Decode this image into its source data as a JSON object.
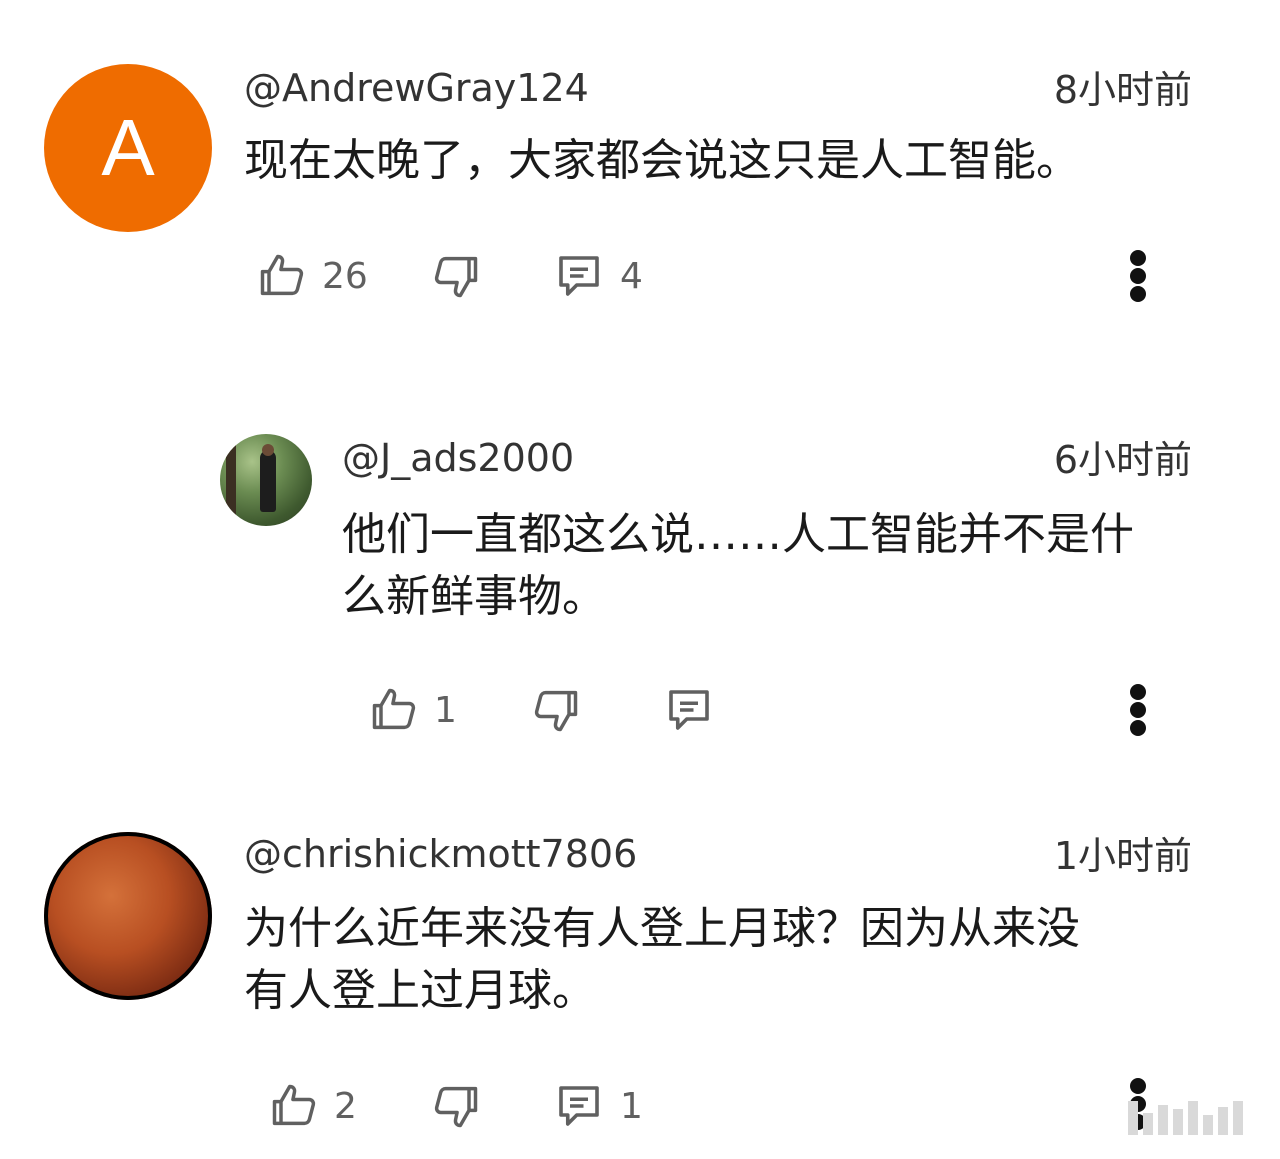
{
  "comments": [
    {
      "avatar_letter": "A",
      "username": "@AndrewGray124",
      "time": "8小时前",
      "text": "现在太晚了，大家都会说这只是人工智能。",
      "likes": "26",
      "replies": "4"
    },
    {
      "username": "@J_ads2000",
      "time": "6小时前",
      "text_line1": "他们一直都这么说……人工智能并不是什",
      "text_line2": "么新鲜事物。",
      "likes": "1"
    },
    {
      "username": "@chrishickmott7806",
      "time": "1小时前",
      "text_line1": "为什么近年来没有人登上月球？因为从来没",
      "text_line2": "有人登上过月球。",
      "likes": "2",
      "replies": "1"
    }
  ],
  "icons": {
    "like": "thumbs-up-icon",
    "dislike": "thumbs-down-icon",
    "reply": "comment-icon",
    "more": "more-vert-icon"
  },
  "colors": {
    "avatar_a": "#ef6c00",
    "text": "#1a1a1a",
    "meta": "#333333",
    "icon": "#606060"
  }
}
